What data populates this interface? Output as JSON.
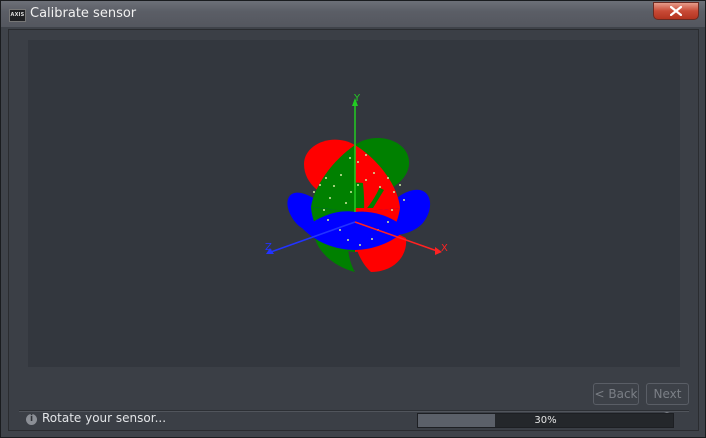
{
  "window": {
    "title": "Calibrate sensor",
    "app_icon_text": "AXIS",
    "close_icon": "close-icon"
  },
  "viewport": {
    "axes": {
      "x_label": "X",
      "y_label": "Y",
      "z_label": "Z",
      "x_color": "#ff2222",
      "y_color": "#22cc22",
      "z_color": "#2233ff"
    },
    "sphere_colors": {
      "red": "#ff0000",
      "green": "#008000",
      "blue": "#0000ff",
      "points": "#cfe8a0"
    }
  },
  "nav": {
    "back_label": "< Back",
    "next_label": "Next >"
  },
  "status": {
    "info_icon": "info-icon",
    "message": "Rotate your sensor...",
    "progress_text": "30%",
    "progress_value": 0.3
  }
}
